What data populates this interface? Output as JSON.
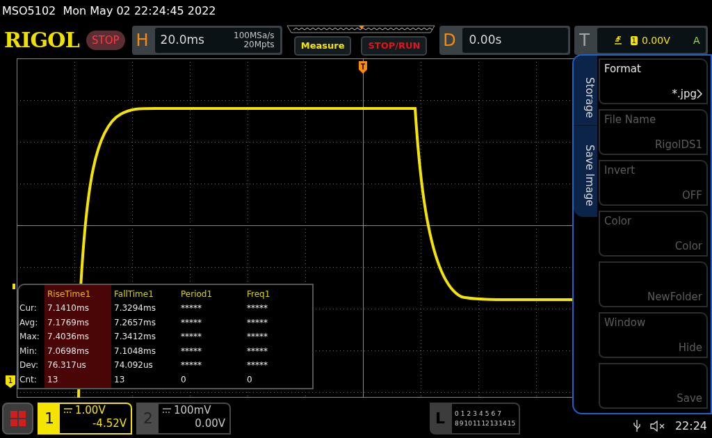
{
  "title_bar": {
    "text": "MSO5102  Mon May 02 22:24:45 2022"
  },
  "logo": "RIGOL",
  "run_state": {
    "label": "STOP",
    "running": false
  },
  "horizontal": {
    "letter": "H",
    "timebase": "20.0ms",
    "sample_rate": "100MSa/s",
    "memory_depth": "20Mpts"
  },
  "buttons": [
    {
      "label": "Measure",
      "kind": "measure"
    },
    {
      "label": "STOP/RUN",
      "kind": "stoprun"
    }
  ],
  "delay": {
    "letter": "D",
    "value": "0.00s"
  },
  "trigger": {
    "letter": "T",
    "source": "1",
    "level": "0.00V",
    "mode": "A"
  },
  "channel_marker": "1",
  "measurements": {
    "columns": [
      {
        "label": "RiseTime1",
        "selected": true
      },
      {
        "label": "FallTime1",
        "selected": false
      },
      {
        "label": "Period1",
        "selected": false
      },
      {
        "label": "Freq1",
        "selected": false
      }
    ],
    "rows": [
      {
        "label": "Cur:",
        "values": [
          "7.1410ms",
          "7.3294ms",
          "*****",
          "*****"
        ]
      },
      {
        "label": "Avg:",
        "values": [
          "7.1769ms",
          "7.2657ms",
          "*****",
          "*****"
        ]
      },
      {
        "label": "Max:",
        "values": [
          "7.4036ms",
          "7.3412ms",
          "*****",
          "*****"
        ]
      },
      {
        "label": "Min:",
        "values": [
          "7.0698ms",
          "7.1048ms",
          "*****",
          "*****"
        ]
      },
      {
        "label": "Dev:",
        "values": [
          "76.317us",
          "74.092us",
          "*****",
          "*****"
        ]
      },
      {
        "label": "Cnt:",
        "values": [
          "13",
          "13",
          "0",
          "0"
        ]
      }
    ]
  },
  "menu": {
    "title": "Storage",
    "subtitle": "Save Image",
    "items": [
      {
        "label": "Format",
        "value": "*.jpg",
        "disabled": false,
        "submenu": true
      },
      {
        "label": "File Name",
        "value": "RigolDS1",
        "disabled": true,
        "submenu": false
      },
      {
        "label": "Invert",
        "value": "OFF",
        "disabled": true,
        "submenu": false
      },
      {
        "label": "Color",
        "value": "Color",
        "disabled": true,
        "submenu": false
      },
      {
        "value": "NewFolder",
        "disabled": true,
        "submenu": false
      },
      {
        "label": "Window",
        "value": "Hide",
        "disabled": true,
        "submenu": false
      },
      {
        "value": "Save",
        "disabled": true,
        "submenu": false
      }
    ]
  },
  "channels": [
    {
      "number": "1",
      "scale": "1.00V",
      "offset": "-4.52V",
      "active": true
    },
    {
      "number": "2",
      "scale": "100mV",
      "offset": "0.00V",
      "active": false
    }
  ],
  "logic": {
    "letter": "L",
    "row1": [
      "0",
      "1",
      "2",
      "3",
      "4",
      "5",
      "6",
      "7"
    ],
    "row2": [
      "8",
      "9",
      "10",
      "11",
      "12",
      "13",
      "14",
      "15"
    ]
  },
  "clock": "22:24"
}
